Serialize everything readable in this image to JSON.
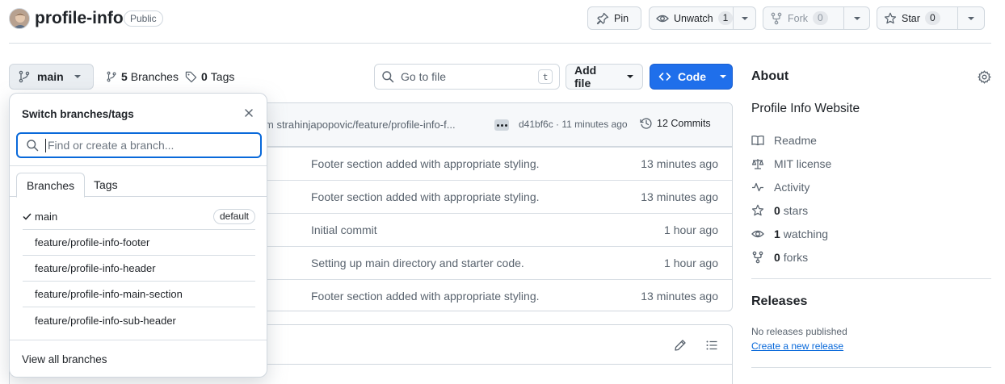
{
  "repo": {
    "name": "profile-info",
    "visibility": "Public"
  },
  "header_actions": {
    "pin_label": "Pin",
    "unwatch_label": "Unwatch",
    "unwatch_count": "1",
    "fork_label": "Fork",
    "fork_count": "0",
    "star_label": "Star",
    "star_count": "0"
  },
  "toolbar": {
    "branch": "main",
    "branches_count": "5",
    "branches_label": "Branches",
    "tags_count": "0",
    "tags_label": "Tags",
    "goto_placeholder": "Go to file",
    "goto_key": "t",
    "add_file_label": "Add file",
    "code_label": "Code"
  },
  "latest_commit": {
    "message": "m strahinjapopovic/feature/profile-info-f...",
    "sha": "d41bf6c",
    "separator": "·",
    "time": "11 minutes ago",
    "commits_label": "12 Commits"
  },
  "files": [
    {
      "message": "Footer section added with appropriate styling.",
      "age": "13 minutes ago"
    },
    {
      "message": "Footer section added with appropriate styling.",
      "age": "13 minutes ago"
    },
    {
      "message": "Initial commit",
      "age": "1 hour ago"
    },
    {
      "message": "Setting up main directory and starter code.",
      "age": "1 hour ago"
    },
    {
      "message": "Footer section added with appropriate styling.",
      "age": "13 minutes ago"
    }
  ],
  "dropdown": {
    "title": "Switch branches/tags",
    "search_placeholder": "Find or create a branch...",
    "tabs": [
      "Branches",
      "Tags"
    ],
    "branches": [
      {
        "name": "main",
        "badge": "default",
        "selected": true
      },
      {
        "name": "feature/profile-info-footer"
      },
      {
        "name": "feature/profile-info-header"
      },
      {
        "name": "feature/profile-info-main-section"
      },
      {
        "name": "feature/profile-info-sub-header"
      }
    ],
    "footer_link": "View all branches"
  },
  "about": {
    "title": "About",
    "description": "Profile Info Website",
    "items": [
      {
        "icon": "book-icon",
        "label": "Readme"
      },
      {
        "icon": "law-icon",
        "label": "MIT license"
      },
      {
        "icon": "pulse-icon",
        "label": "Activity"
      },
      {
        "icon": "star-icon",
        "count": "0",
        "label": "stars"
      },
      {
        "icon": "eye-icon",
        "count": "1",
        "label": "watching"
      },
      {
        "icon": "fork-icon",
        "count": "0",
        "label": "forks"
      }
    ]
  },
  "releases": {
    "title": "Releases",
    "none_text": "No releases published",
    "create_link": "Create a new release"
  },
  "colors": {
    "accent": "#0969da",
    "code_button": "#1f6feb",
    "border": "#d0d7de"
  }
}
